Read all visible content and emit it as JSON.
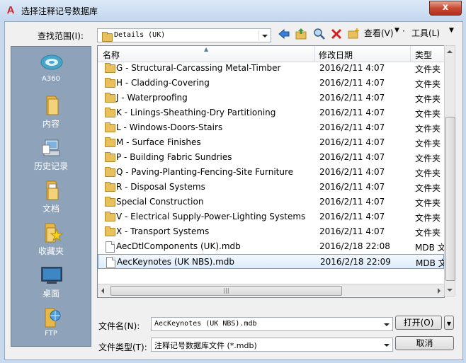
{
  "window": {
    "title": "选择注释记号数据库",
    "app_icon_glyph": "A",
    "close_glyph": "x"
  },
  "lookin": {
    "label": "查找范围(I):",
    "value": "Details (UK)"
  },
  "toolbar": {
    "view_label": "查看(V)",
    "tools_label": "工具(L)"
  },
  "places": [
    {
      "label": "A360",
      "icon": "a360-cloud-icon"
    },
    {
      "label": "内容",
      "icon": "folder-icon"
    },
    {
      "label": "历史记录",
      "icon": "history-icon"
    },
    {
      "label": "文档",
      "icon": "documents-icon"
    },
    {
      "label": "收藏夹",
      "icon": "favorites-icon"
    },
    {
      "label": "桌面",
      "icon": "desktop-icon"
    },
    {
      "label": "FTP",
      "icon": "ftp-icon"
    }
  ],
  "columns": {
    "name": "名称",
    "date": "修改日期",
    "type": "类型"
  },
  "files": [
    {
      "name": "G - Structural-Carcassing Metal-Timber",
      "date": "2016/2/11 4:07",
      "type": "文件夹",
      "kind": "folder"
    },
    {
      "name": "H - Cladding-Covering",
      "date": "2016/2/11 4:07",
      "type": "文件夹",
      "kind": "folder"
    },
    {
      "name": "J - Waterproofing",
      "date": "2016/2/11 4:07",
      "type": "文件夹",
      "kind": "folder"
    },
    {
      "name": "K - Linings-Sheathing-Dry Partitioning",
      "date": "2016/2/11 4:07",
      "type": "文件夹",
      "kind": "folder"
    },
    {
      "name": "L - Windows-Doors-Stairs",
      "date": "2016/2/11 4:07",
      "type": "文件夹",
      "kind": "folder"
    },
    {
      "name": "M - Surface Finishes",
      "date": "2016/2/11 4:07",
      "type": "文件夹",
      "kind": "folder"
    },
    {
      "name": "P - Building Fabric Sundries",
      "date": "2016/2/11 4:07",
      "type": "文件夹",
      "kind": "folder"
    },
    {
      "name": "Q - Paving-Planting-Fencing-Site Furniture",
      "date": "2016/2/11 4:07",
      "type": "文件夹",
      "kind": "folder"
    },
    {
      "name": "R - Disposal Systems",
      "date": "2016/2/11 4:07",
      "type": "文件夹",
      "kind": "folder"
    },
    {
      "name": "Special Construction",
      "date": "2016/2/11 4:07",
      "type": "文件夹",
      "kind": "folder"
    },
    {
      "name": "V - Electrical Supply-Power-Lighting Systems",
      "date": "2016/2/11 4:07",
      "type": "文件夹",
      "kind": "folder"
    },
    {
      "name": "X - Transport Systems",
      "date": "2016/2/11 4:07",
      "type": "文件夹",
      "kind": "folder"
    },
    {
      "name": "AecDtlComponents (UK).mdb",
      "date": "2016/2/18 22:08",
      "type": "MDB 文",
      "kind": "file"
    },
    {
      "name": "AecKeynotes (UK NBS).mdb",
      "date": "2016/2/18 22:09",
      "type": "MDB 文",
      "kind": "file",
      "selected": true
    }
  ],
  "filename": {
    "label": "文件名(N):",
    "value": "AecKeynotes (UK NBS).mdb"
  },
  "filetype": {
    "label": "文件类型(T):",
    "value": "注释记号数据库文件 (*.mdb)"
  },
  "buttons": {
    "open": "打开(O)",
    "cancel": "取消"
  },
  "colors": {
    "titlebar": "#c3d7ef",
    "places_panel": "#8ea2b9",
    "selection": "#dcebfc",
    "folder": "#e9c15c"
  }
}
